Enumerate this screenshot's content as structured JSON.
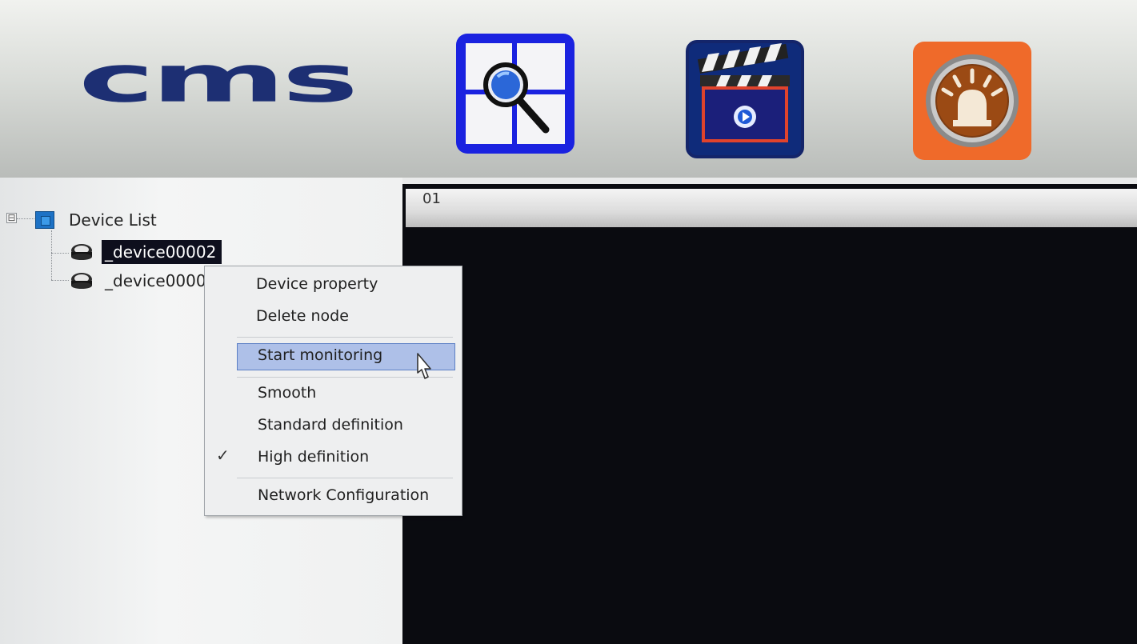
{
  "app": {
    "logo_text": "cms"
  },
  "toolbar": {
    "buttons": [
      {
        "name": "search",
        "icon": "magnifier-grid-icon",
        "color": "#1a22e0"
      },
      {
        "name": "record",
        "icon": "clapperboard-icon",
        "color": "#0f2b7a"
      },
      {
        "name": "alarm",
        "icon": "siren-icon",
        "color": "#ef6a2a"
      }
    ]
  },
  "device_tree": {
    "root_label": "Device List",
    "expander": "⊟",
    "devices": [
      {
        "label": "_device00002",
        "selected": true
      },
      {
        "label": "_device0000",
        "selected": false
      }
    ]
  },
  "video": {
    "channel_label": "01"
  },
  "context_menu": {
    "items": [
      {
        "label": "Device property"
      },
      {
        "label": "Delete node"
      },
      {
        "label": "Start monitoring",
        "highlighted": true
      },
      {
        "label": "Smooth"
      },
      {
        "label": "Standard definition"
      },
      {
        "label": "High definition",
        "checked": true
      },
      {
        "label": "Network Configuration"
      }
    ],
    "check_glyph": "✓"
  }
}
